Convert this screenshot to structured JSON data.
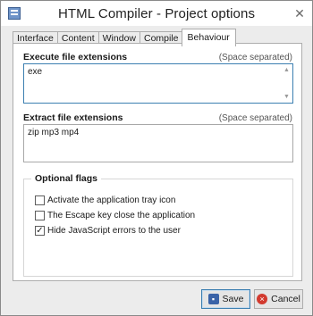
{
  "window": {
    "title": "HTML Compiler - Project options",
    "close_glyph": "✕"
  },
  "tabs": [
    {
      "label": "Interface"
    },
    {
      "label": "Content"
    },
    {
      "label": "Window"
    },
    {
      "label": "Compile"
    },
    {
      "label": "Behaviour",
      "active": true
    }
  ],
  "execute": {
    "label": "Execute file extensions",
    "hint": "(Space separated)",
    "value": "exe"
  },
  "extract": {
    "label": "Extract file extensions",
    "hint": "(Space separated)",
    "value": "zip mp3 mp4"
  },
  "optional_flags": {
    "title": "Optional flags",
    "items": [
      {
        "label": "Activate the application tray icon",
        "checked": false
      },
      {
        "label": "The Escape key close the application",
        "checked": false
      },
      {
        "label": "Hide JavaScript errors to the user",
        "checked": true
      }
    ]
  },
  "buttons": {
    "save": "Save",
    "cancel": "Cancel"
  },
  "icons": {
    "app": "app-icon",
    "save": "floppy-icon",
    "cancel": "cancel-icon"
  },
  "colors": {
    "focus_border": "#3c7fb1",
    "cancel_red": "#d23a2f",
    "save_blue": "#3a63a8"
  }
}
